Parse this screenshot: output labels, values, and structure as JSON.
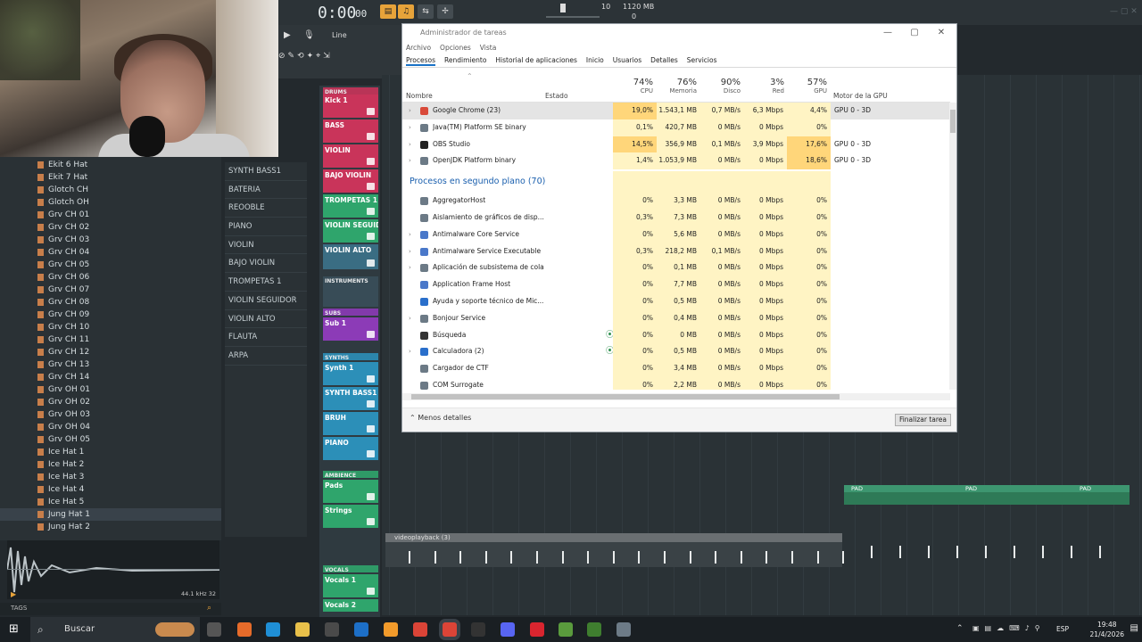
{
  "daw": {
    "timecode": "0:00",
    "timecode_small": "00",
    "snap": "Line",
    "tempo_info": "10",
    "mem_info": "1120 MB",
    "mem_zero": "0"
  },
  "browser": {
    "items": [
      "Ekit 6 Hat",
      "Ekit 7 Hat",
      "Glotch CH",
      "Glotch OH",
      "Grv CH 01",
      "Grv CH 02",
      "Grv CH 03",
      "Grv CH 04",
      "Grv CH 05",
      "Grv CH 06",
      "Grv CH 07",
      "Grv CH 08",
      "Grv CH 09",
      "Grv CH 10",
      "Grv CH 11",
      "Grv CH 12",
      "Grv CH 13",
      "Grv CH 14",
      "Grv OH 01",
      "Grv OH 02",
      "Grv OH 03",
      "Grv OH 04",
      "Grv OH 05",
      "Ice Hat 1",
      "Ice Hat 2",
      "Ice Hat 3",
      "Ice Hat 4",
      "Ice Hat 5",
      "Jung Hat 1",
      "Jung Hat 2"
    ],
    "selected": "Jung Hat 1",
    "sample_info": "44.1 kHz 32",
    "tags_label": "TAGS"
  },
  "mixer_names": [
    "SYNTH BASS1",
    "BATERIA",
    "REOOBLE",
    "PIANO",
    "VIOLIN",
    "BAJO VIOLIN",
    "TROMPETAS 1",
    "VIOLIN SEGUIDOR",
    "VIOLIN ALTO",
    "FLAUTA",
    "ARPA"
  ],
  "rack": {
    "slots": [
      {
        "label": "DRUMS",
        "color": "#c9345a",
        "kind": "header"
      },
      {
        "label": "Kick 1",
        "color": "#c9345a"
      },
      {
        "label": "BASS",
        "color": "#c9345a"
      },
      {
        "label": "VIOLIN",
        "color": "#c9345a"
      },
      {
        "label": "BAJO VIOLIN",
        "color": "#c9345a"
      },
      {
        "label": "TROMPETAS 1",
        "color": "#2fa56c"
      },
      {
        "label": "VIOLIN SEGUIDOR",
        "color": "#2fa56c"
      },
      {
        "label": "VIOLIN ALTO",
        "color": "#3a6d83"
      },
      {
        "label": "INSTRUMENTS",
        "color": "#3a4f5a",
        "kind": "header"
      },
      {
        "label": "SUBS",
        "color": "#8c3bb7",
        "kind": "header"
      },
      {
        "label": "Sub 1",
        "color": "#8c3bb7"
      },
      {
        "label": "SYNTHS",
        "color": "#2c8fb8",
        "kind": "header"
      },
      {
        "label": "Synth 1",
        "color": "#2c8fb8"
      },
      {
        "label": "SYNTH BASS1",
        "color": "#2c8fb8"
      },
      {
        "label": "BRUH",
        "color": "#2c8fb8"
      },
      {
        "label": "PIANO",
        "color": "#2c8fb8"
      },
      {
        "label": "AMBIENCE",
        "color": "#2fa56c",
        "kind": "header"
      },
      {
        "label": "Pads",
        "color": "#2fa56c"
      },
      {
        "label": "Strings",
        "color": "#2fa56c"
      },
      {
        "label": "VOCALS",
        "color": "#2fa56c",
        "kind": "header"
      },
      {
        "label": "Vocals 1",
        "color": "#2fa56c"
      },
      {
        "label": "Vocals 2",
        "color": "#2fa56c"
      }
    ]
  },
  "playlist": {
    "clip_label": "videoplayback (3)",
    "pad_label": "PAD"
  },
  "taskmanager": {
    "title": "Administrador de tareas",
    "menu": [
      "Archivo",
      "Opciones",
      "Vista"
    ],
    "tabs": [
      "Procesos",
      "Rendimiento",
      "Historial de aplicaciones",
      "Inicio",
      "Usuarios",
      "Detalles",
      "Servicios"
    ],
    "active_tab": "Procesos",
    "col_name": "Nombre",
    "col_status": "Estado",
    "cols": [
      {
        "pct": "74%",
        "label": "CPU"
      },
      {
        "pct": "76%",
        "label": "Memoria"
      },
      {
        "pct": "90%",
        "label": "Disco"
      },
      {
        "pct": "3%",
        "label": "Red"
      },
      {
        "pct": "57%",
        "label": "GPU"
      }
    ],
    "col_gpu_engine": "Motor de la GPU",
    "apps": [
      {
        "name": "Google Chrome (23)",
        "cpu": "19,0%",
        "mem": "1.543,1 MB",
        "disk": "0,7 MB/s",
        "net": "6,3 Mbps",
        "gpu": "4,4%",
        "engine": "GPU 0 - 3D",
        "icon": "#d94a3a"
      },
      {
        "name": "Java(TM) Platform SE binary",
        "cpu": "0,1%",
        "mem": "420,7 MB",
        "disk": "0 MB/s",
        "net": "0 Mbps",
        "gpu": "0%",
        "engine": "",
        "icon": "#6c7a86"
      },
      {
        "name": "OBS Studio",
        "cpu": "14,5%",
        "mem": "356,9 MB",
        "disk": "0,1 MB/s",
        "net": "3,9 Mbps",
        "gpu": "17,6%",
        "engine": "GPU 0 - 3D",
        "icon": "#222222"
      },
      {
        "name": "OpenJDK Platform binary",
        "cpu": "1,4%",
        "mem": "1.053,9 MB",
        "disk": "0 MB/s",
        "net": "0 Mbps",
        "gpu": "18,6%",
        "engine": "GPU 0 - 3D",
        "icon": "#6c7a86"
      }
    ],
    "bg_group": "Procesos en segundo plano (70)",
    "bg": [
      {
        "name": "AggregatorHost",
        "cpu": "0%",
        "mem": "3,3 MB",
        "disk": "0 MB/s",
        "net": "0 Mbps",
        "gpu": "0%",
        "icon": "#6c7a86"
      },
      {
        "name": "Aislamiento de gráficos de disp...",
        "cpu": "0,3%",
        "mem": "7,3 MB",
        "disk": "0 MB/s",
        "net": "0 Mbps",
        "gpu": "0%",
        "icon": "#6c7a86"
      },
      {
        "name": "Antimalware Core Service",
        "cpu": "0%",
        "mem": "5,6 MB",
        "disk": "0 MB/s",
        "net": "0 Mbps",
        "gpu": "0%",
        "icon": "#4a78c9"
      },
      {
        "name": "Antimalware Service Executable",
        "cpu": "0,3%",
        "mem": "218,2 MB",
        "disk": "0,1 MB/s",
        "net": "0 Mbps",
        "gpu": "0%",
        "icon": "#4a78c9"
      },
      {
        "name": "Aplicación de subsistema de cola",
        "cpu": "0%",
        "mem": "0,1 MB",
        "disk": "0 MB/s",
        "net": "0 Mbps",
        "gpu": "0%",
        "icon": "#6c7a86"
      },
      {
        "name": "Application Frame Host",
        "cpu": "0%",
        "mem": "7,7 MB",
        "disk": "0 MB/s",
        "net": "0 Mbps",
        "gpu": "0%",
        "icon": "#4a78c9"
      },
      {
        "name": "Ayuda y soporte técnico de Mic...",
        "cpu": "0%",
        "mem": "0,5 MB",
        "disk": "0 MB/s",
        "net": "0 Mbps",
        "gpu": "0%",
        "icon": "#2a6fcb"
      },
      {
        "name": "Bonjour Service",
        "cpu": "0%",
        "mem": "0,4 MB",
        "disk": "0 MB/s",
        "net": "0 Mbps",
        "gpu": "0%",
        "icon": "#6c7a86"
      },
      {
        "name": "Búsqueda",
        "cpu": "0%",
        "mem": "0 MB",
        "disk": "0 MB/s",
        "net": "0 Mbps",
        "gpu": "0%",
        "icon": "#333333"
      },
      {
        "name": "Calculadora (2)",
        "cpu": "0%",
        "mem": "0,5 MB",
        "disk": "0 MB/s",
        "net": "0 Mbps",
        "gpu": "0%",
        "icon": "#2a6fcb"
      },
      {
        "name": "Cargador de CTF",
        "cpu": "0%",
        "mem": "3,4 MB",
        "disk": "0 MB/s",
        "net": "0 Mbps",
        "gpu": "0%",
        "icon": "#6c7a86"
      },
      {
        "name": "COM Surrogate",
        "cpu": "0%",
        "mem": "2,2 MB",
        "disk": "0 MB/s",
        "net": "0 Mbps",
        "gpu": "0%",
        "icon": "#6c7a86"
      }
    ],
    "less_details": "Menos detalles",
    "end_task": "Finalizar tarea"
  },
  "taskbar": {
    "search": "Buscar",
    "lang": "ESP",
    "time": "19:48",
    "date": "21/4/2026"
  }
}
